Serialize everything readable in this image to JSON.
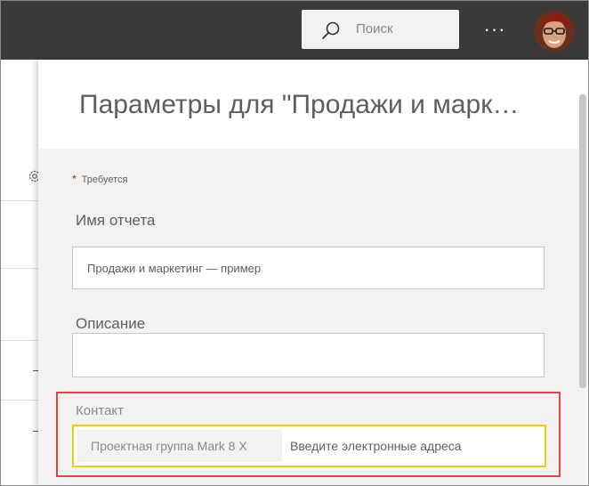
{
  "topbar": {
    "search": {
      "placeholder": "Поиск",
      "icon": "search-icon"
    },
    "more_label": "···",
    "avatar": "user-avatar"
  },
  "panel": {
    "title": "Параметры для \"Продажи и марк…",
    "required_label": "Требуется",
    "required_marker": "*",
    "fields": {
      "report_name": {
        "label": "Имя отчета",
        "value": "Продажи и маркетинг — пример"
      },
      "description": {
        "label": "Описание",
        "value": ""
      },
      "contact": {
        "label": "Контакт",
        "chip": "Проектная группа Mark 8 X",
        "placeholder": "Введите электронные адреса"
      }
    }
  },
  "colors": {
    "topbar": "#3b3a39",
    "highlight": "#e8414a",
    "focus_border": "#f2c811",
    "required": "#c50f1f"
  }
}
